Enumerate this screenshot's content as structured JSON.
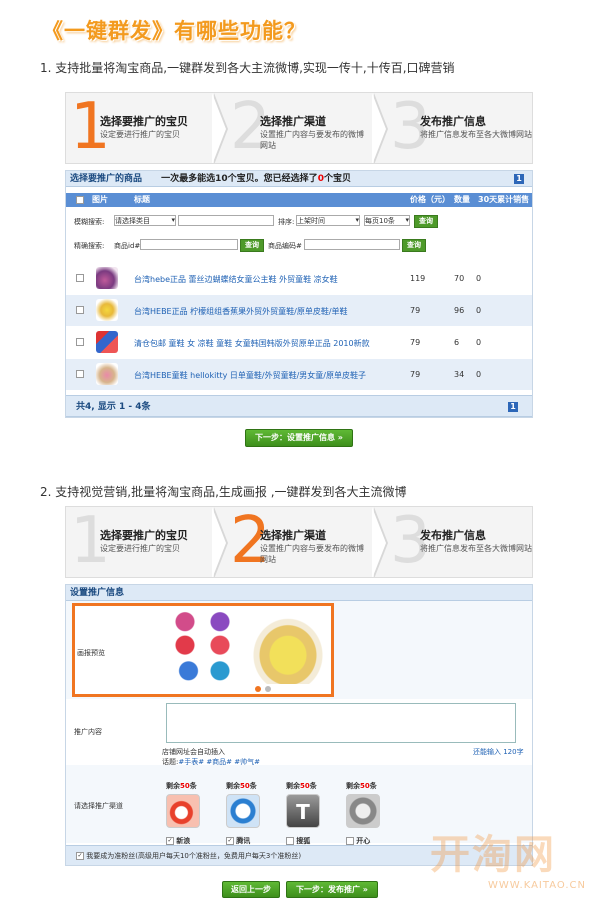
{
  "title": "《一键群发》有哪些功能？",
  "sec1": {
    "text": "1.  支持批量将淘宝商品,一键群发到各大主流微博,实现一传十,十传百,口碑营销"
  },
  "sec2": {
    "text": "2.  支持视觉营销,批量将淘宝商品,生成画报 ,一键群发到各大主流微博"
  },
  "steps": [
    {
      "num": "1",
      "title": "选择要推广的宝贝",
      "desc": "设定要进行推广的宝贝"
    },
    {
      "num": "2",
      "title": "选择推广渠道",
      "desc": "设置推广内容与要发布的微博网站"
    },
    {
      "num": "3",
      "title": "发布推广信息",
      "desc": "将推广信息发布至各大微博网站"
    }
  ],
  "products": {
    "bar_title": "选择要推广的商品",
    "bar_note_prefix": "一次最多能选10个宝贝。您已经选择了",
    "bar_note_count": "0",
    "bar_note_suffix": "个宝贝",
    "page_badge": "1",
    "headers": {
      "image": "图片",
      "title": "标题",
      "price": "价格（元）",
      "qty": "数量",
      "sales": "30天累计销售"
    },
    "filter": {
      "fuzzy_label": "模糊搜索:",
      "category_value": "请选择类目",
      "sort_label": "排序:",
      "sort_value": "上架时间",
      "per_page_value": "每页10条",
      "search_label": "查询",
      "exact_label": "精确搜索:",
      "item_id_label": "商品id#",
      "item_code_label": "商品编码#"
    },
    "rows": [
      {
        "title": "台湾hebe正品 蕾丝边蝴蝶结女童公主鞋 外贸童鞋 凉女鞋",
        "price": "119",
        "qty": "70",
        "sales": "0"
      },
      {
        "title": "台湾HEBE正品 柠檬组组香蕉果外贸外贸童鞋/原单皮鞋/单鞋",
        "price": "79",
        "qty": "96",
        "sales": "0"
      },
      {
        "title": "清仓包邮 童鞋 女 凉鞋 童鞋 女童韩国韩版外贸原单正品 2010新款",
        "price": "79",
        "qty": "6",
        "sales": "0"
      },
      {
        "title": "台湾HEBE童鞋 hellokitty 日单童鞋/外贸童鞋/男女童/原单皮鞋子",
        "price": "79",
        "qty": "34",
        "sales": "0"
      }
    ],
    "footer": "共4, 显示 1 - 4条",
    "footer_page": "1",
    "next_button": "下一步：设置推广信息 »"
  },
  "promo": {
    "bar_title": "设置推广信息",
    "preview_label": "画报预览",
    "content_label": "推广内容",
    "shortlink_note": "店铺网址会自动插入",
    "topic_label": "话题:",
    "topic_value": "#手表# #商品# #帅气#",
    "counter": "还能输入 120字",
    "channel_label": "请选择推广渠道",
    "channels": [
      {
        "remain_prefix": "剩余",
        "remain": "50",
        "remain_suffix": "条",
        "name": "新浪",
        "checked": true,
        "color": "#e8412c"
      },
      {
        "remain_prefix": "剩余",
        "remain": "50",
        "remain_suffix": "条",
        "name": "腾讯",
        "checked": true,
        "color": "#2b7fd1"
      },
      {
        "remain_prefix": "剩余",
        "remain": "50",
        "remain_suffix": "条",
        "name": "搜狐",
        "checked": false,
        "color": "#555555"
      },
      {
        "remain_prefix": "剩余",
        "remain": "50",
        "remain_suffix": "条",
        "name": "开心",
        "checked": false,
        "color": "#888888"
      }
    ],
    "fans_note": "我要成为准粉丝(高级用户每天10个准粉丝，免费用户每天3个准粉丝)",
    "back_button": "返回上一步",
    "publish_button": "下一步：发布推广 »"
  },
  "watermark": {
    "logo": "开淘网",
    "url": "WWW.KAITAO.CN"
  }
}
